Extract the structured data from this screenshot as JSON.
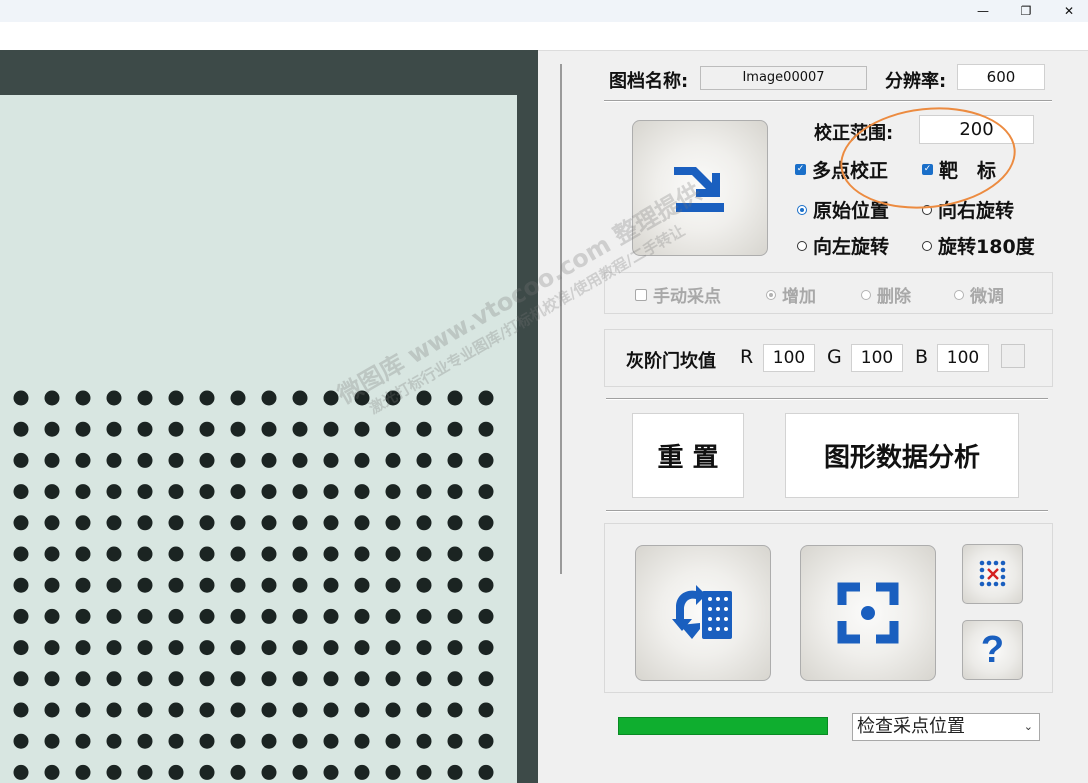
{
  "window": {
    "minimize_glyph": "—",
    "restore_glyph": "❐",
    "close_glyph": "✕"
  },
  "form": {
    "image_name_label": "图档名称:",
    "image_name_value": "Image00007",
    "resolution_label": "分辨率:",
    "resolution_value": "600",
    "range_label": "校正范围:",
    "range_value": "200",
    "multipoint_label": "多点校正",
    "multipoint_checked": true,
    "target_label": "靶　标",
    "target_checked": true,
    "rotation": {
      "options": [
        "原始位置",
        "向右旋转",
        "向左旋转",
        "旋转180度"
      ],
      "selected": "原始位置"
    }
  },
  "manual_sampling": {
    "checkbox_label": "手动采点",
    "checked": false,
    "options": [
      "增加",
      "删除",
      "微调"
    ],
    "selected": "增加"
  },
  "threshold": {
    "label": "灰阶门坎值",
    "r_label": "R",
    "r_value": "100",
    "g_label": "G",
    "g_value": "100",
    "b_label": "B",
    "b_value": "100"
  },
  "buttons": {
    "reset": "重 置",
    "analyze": "图形数据分析",
    "help_glyph": "?"
  },
  "bottom": {
    "progress": 1.0,
    "progress_color": "#0fae2f",
    "dropdown_value": "检查采点位置"
  },
  "watermark": {
    "line1": "微图库 www.vtocoo.com 整理提供",
    "line2": "激光打标行业专业图库/打标机校准/使用教程/二手转让"
  },
  "colors": {
    "accent": "#1a6fc9",
    "annotation": "#ec8b40"
  },
  "icons": [
    "import-arrow-icon",
    "rotate-grid-icon",
    "focus-target-icon",
    "dot-grid-cross-icon",
    "help-question-icon"
  ]
}
